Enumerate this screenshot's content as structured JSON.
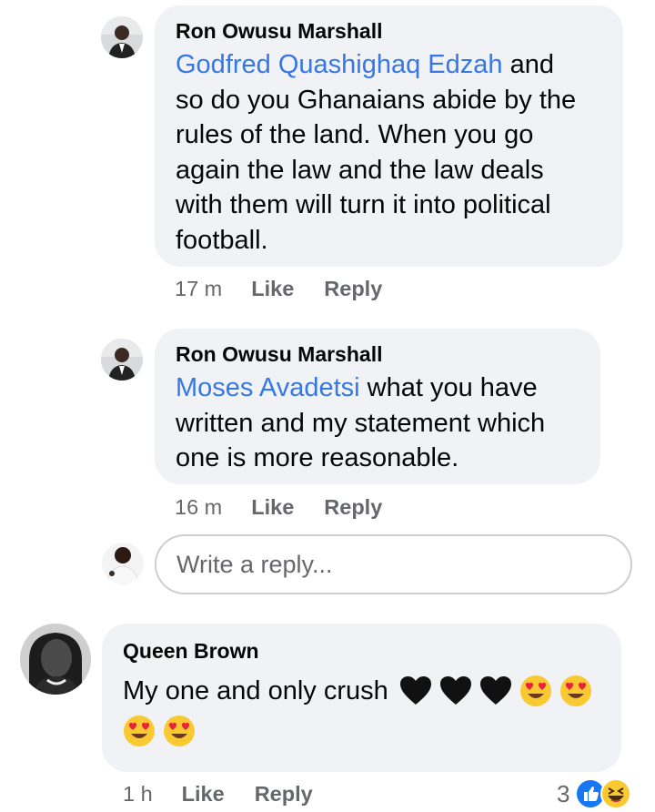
{
  "comments": [
    {
      "author": "Ron Owusu Marshall",
      "mention": "Godfred Quashighaq Edzah",
      "text_line1": " and",
      "lines": [
        "so do you Ghanaians abide by the",
        "rules of the land. When you go",
        "again the law and the law deals",
        "with them will turn it into political",
        "football."
      ],
      "time": "17 m",
      "like": "Like",
      "reply": "Reply"
    },
    {
      "author": "Ron Owusu Marshall",
      "mention": "Moses Avadetsi",
      "text_line1": " what you have",
      "lines": [
        "written and my statement which",
        "one is more reasonable."
      ],
      "time": "16 m",
      "like": "Like",
      "reply": "Reply"
    },
    {
      "author": "Queen Brown",
      "text_line1": "My one and only crush",
      "time": "1 h",
      "like": "Like",
      "reply": "Reply",
      "reaction_count": "3",
      "emojis_line1": [
        "black-heart",
        "black-heart",
        "black-heart",
        "heart-eyes",
        "heart-eyes"
      ],
      "emojis_line2": [
        "heart-eyes",
        "heart-eyes"
      ],
      "reaction_icons": [
        "like-reaction",
        "haha-reaction"
      ]
    }
  ],
  "reply_input": {
    "placeholder": "Write a reply..."
  },
  "colors": {
    "mention": "#3578e5",
    "bubble": "#f0f2f5",
    "meta": "#65676b",
    "like_blue": "#1877f2"
  }
}
